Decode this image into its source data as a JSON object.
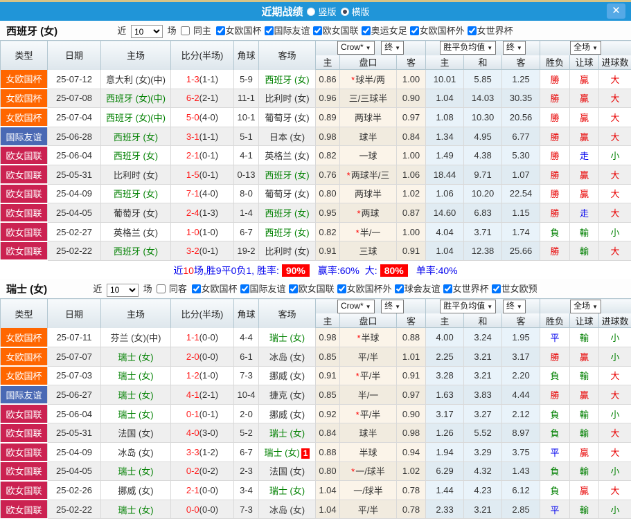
{
  "titlebar": {
    "title": "近期战绩",
    "radio_vertical": "竖版",
    "radio_horizontal": "横版",
    "close": "✕"
  },
  "accent_colors": {
    "bar_blue": "#2095d8",
    "cup_orange": "#ff6600",
    "friendly_blue": "#4a69b4",
    "league_pink": "#cb2251",
    "win_red": "#ff0000",
    "lose_green": "#008000",
    "draw_blue": "#0000ee"
  },
  "table": {
    "main_cols": [
      "类型",
      "日期",
      "主场",
      "比分(半场)",
      "角球",
      "客场"
    ],
    "sub_cols": [
      "主",
      "盘口",
      "客",
      "主",
      "和",
      "客",
      "胜负",
      "让球",
      "进球数"
    ],
    "controls": {
      "odds_source": "Crow*",
      "final_a": "终",
      "avg": "胜平负均值",
      "final_b": "终",
      "scope": "全场"
    }
  },
  "filters_common": {
    "near": "近",
    "count": "10",
    "matches": "场"
  },
  "sections": [
    {
      "team": "西班牙 (女)",
      "same": "同主",
      "comps": [
        "女欧国杯",
        "国际友谊",
        "欧女国联",
        "奥运女足",
        "女欧国杯外",
        "女世界杯"
      ],
      "rows": [
        {
          "type": "女欧国杯",
          "tc": "o",
          "date": "25-07-12",
          "home": "意大利 (女)(中)",
          "hg": 0,
          "score": "1-3",
          "half": "(1-1)",
          "corner": "5-9",
          "away": "西班牙 (女)",
          "ag": 1,
          "badge": "",
          "o1": "0.86",
          "star": 1,
          "hcap": "球半/两",
          "o2": "1.00",
          "m1": "10.01",
          "m2": "5.85",
          "m3": "1.25",
          "r": "勝",
          "rc": "r",
          "lb": "贏",
          "lbc": "r",
          "gl": "大",
          "glc": "r"
        },
        {
          "type": "女欧国杯",
          "tc": "o",
          "date": "25-07-08",
          "home": "西班牙 (女)(中)",
          "hg": 1,
          "score": "6-2",
          "half": "(2-1)",
          "corner": "11-1",
          "away": "比利时 (女)",
          "ag": 0,
          "badge": "",
          "o1": "0.96",
          "star": 0,
          "hcap": "三/三球半",
          "o2": "0.90",
          "m1": "1.04",
          "m2": "14.03",
          "m3": "30.35",
          "r": "勝",
          "rc": "r",
          "lb": "贏",
          "lbc": "r",
          "gl": "大",
          "glc": "r"
        },
        {
          "type": "女欧国杯",
          "tc": "o",
          "date": "25-07-04",
          "home": "西班牙 (女)(中)",
          "hg": 1,
          "score": "5-0",
          "half": "(4-0)",
          "corner": "10-1",
          "away": "葡萄牙 (女)",
          "ag": 0,
          "badge": "",
          "o1": "0.89",
          "star": 0,
          "hcap": "两球半",
          "o2": "0.97",
          "m1": "1.08",
          "m2": "10.30",
          "m3": "20.56",
          "r": "勝",
          "rc": "r",
          "lb": "贏",
          "lbc": "r",
          "gl": "大",
          "glc": "r"
        },
        {
          "type": "国际友谊",
          "tc": "b",
          "date": "25-06-28",
          "home": "西班牙 (女)",
          "hg": 1,
          "score": "3-1",
          "half": "(1-1)",
          "corner": "5-1",
          "away": "日本 (女)",
          "ag": 0,
          "badge": "",
          "o1": "0.98",
          "star": 0,
          "hcap": "球半",
          "o2": "0.84",
          "m1": "1.34",
          "m2": "4.95",
          "m3": "6.77",
          "r": "勝",
          "rc": "r",
          "lb": "贏",
          "lbc": "r",
          "gl": "大",
          "glc": "r"
        },
        {
          "type": "欧女国联",
          "tc": "p",
          "date": "25-06-04",
          "home": "西班牙 (女)",
          "hg": 1,
          "score": "2-1",
          "half": "(0-1)",
          "corner": "4-1",
          "away": "英格兰 (女)",
          "ag": 0,
          "badge": "",
          "o1": "0.82",
          "star": 0,
          "hcap": "一球",
          "o2": "1.00",
          "m1": "1.49",
          "m2": "4.38",
          "m3": "5.30",
          "r": "勝",
          "rc": "r",
          "lb": "走",
          "lbc": "b",
          "gl": "小",
          "glc": "g"
        },
        {
          "type": "欧女国联",
          "tc": "p",
          "date": "25-05-31",
          "home": "比利时 (女)",
          "hg": 0,
          "score": "1-5",
          "half": "(0-1)",
          "corner": "0-13",
          "away": "西班牙 (女)",
          "ag": 1,
          "badge": "",
          "o1": "0.76",
          "star": 1,
          "hcap": "两球半/三",
          "o2": "1.06",
          "m1": "18.44",
          "m2": "9.71",
          "m3": "1.07",
          "r": "勝",
          "rc": "r",
          "lb": "贏",
          "lbc": "r",
          "gl": "大",
          "glc": "r"
        },
        {
          "type": "欧女国联",
          "tc": "p",
          "date": "25-04-09",
          "home": "西班牙 (女)",
          "hg": 1,
          "score": "7-1",
          "half": "(4-0)",
          "corner": "8-0",
          "away": "葡萄牙 (女)",
          "ag": 0,
          "badge": "",
          "o1": "0.80",
          "star": 0,
          "hcap": "两球半",
          "o2": "1.02",
          "m1": "1.06",
          "m2": "10.20",
          "m3": "22.54",
          "r": "勝",
          "rc": "r",
          "lb": "贏",
          "lbc": "r",
          "gl": "大",
          "glc": "r"
        },
        {
          "type": "欧女国联",
          "tc": "p",
          "date": "25-04-05",
          "home": "葡萄牙 (女)",
          "hg": 0,
          "score": "2-4",
          "half": "(1-3)",
          "corner": "1-4",
          "away": "西班牙 (女)",
          "ag": 1,
          "badge": "",
          "o1": "0.95",
          "star": 1,
          "hcap": "两球",
          "o2": "0.87",
          "m1": "14.60",
          "m2": "6.83",
          "m3": "1.15",
          "r": "勝",
          "rc": "r",
          "lb": "走",
          "lbc": "b",
          "gl": "大",
          "glc": "r"
        },
        {
          "type": "欧女国联",
          "tc": "p",
          "date": "25-02-27",
          "home": "英格兰 (女)",
          "hg": 0,
          "score": "1-0",
          "half": "(1-0)",
          "corner": "6-7",
          "away": "西班牙 (女)",
          "ag": 1,
          "badge": "",
          "o1": "0.82",
          "star": 1,
          "hcap": "半/一",
          "o2": "1.00",
          "m1": "4.04",
          "m2": "3.71",
          "m3": "1.74",
          "r": "負",
          "rc": "g",
          "lb": "輸",
          "lbc": "g",
          "gl": "小",
          "glc": "g"
        },
        {
          "type": "欧女国联",
          "tc": "p",
          "date": "25-02-22",
          "home": "西班牙 (女)",
          "hg": 1,
          "score": "3-2",
          "half": "(0-1)",
          "corner": "19-2",
          "away": "比利时 (女)",
          "ag": 0,
          "badge": "",
          "o1": "0.91",
          "star": 0,
          "hcap": "三球",
          "o2": "0.91",
          "m1": "1.04",
          "m2": "12.38",
          "m3": "25.66",
          "r": "勝",
          "rc": "r",
          "lb": "輸",
          "lbc": "g",
          "gl": "大",
          "glc": "r"
        }
      ],
      "summary": {
        "t1": "近",
        "t2": "10",
        "t3": "场,胜9平0负1, 胜率:",
        "b1": "90%",
        "t4": "赢率:",
        "t5": "60%",
        "t6": "大:",
        "b2": "80%",
        "t7": "单率:",
        "t8": "40%"
      }
    },
    {
      "team": "瑞士 (女)",
      "same": "同客",
      "comps": [
        "女欧国杯",
        "国际友谊",
        "欧女国联",
        "女欧国杯外",
        "球会友谊",
        "女世界杯",
        "世女欧预"
      ],
      "rows": [
        {
          "type": "女欧国杯",
          "tc": "o",
          "date": "25-07-11",
          "home": "芬兰 (女)(中)",
          "hg": 0,
          "score": "1-1",
          "half": "(0-0)",
          "corner": "4-4",
          "away": "瑞士 (女)",
          "ag": 1,
          "badge": "",
          "o1": "0.98",
          "star": 1,
          "hcap": "半球",
          "o2": "0.88",
          "m1": "4.00",
          "m2": "3.24",
          "m3": "1.95",
          "r": "平",
          "rc": "b",
          "lb": "輸",
          "lbc": "g",
          "gl": "小",
          "glc": "g"
        },
        {
          "type": "女欧国杯",
          "tc": "o",
          "date": "25-07-07",
          "home": "瑞士 (女)",
          "hg": 1,
          "score": "2-0",
          "half": "(0-0)",
          "corner": "6-1",
          "away": "冰岛 (女)",
          "ag": 0,
          "badge": "",
          "o1": "0.85",
          "star": 0,
          "hcap": "平/半",
          "o2": "1.01",
          "m1": "2.25",
          "m2": "3.21",
          "m3": "3.17",
          "r": "勝",
          "rc": "r",
          "lb": "贏",
          "lbc": "r",
          "gl": "小",
          "glc": "g"
        },
        {
          "type": "女欧国杯",
          "tc": "o",
          "date": "25-07-03",
          "home": "瑞士 (女)",
          "hg": 1,
          "score": "1-2",
          "half": "(1-0)",
          "corner": "7-3",
          "away": "挪威 (女)",
          "ag": 0,
          "badge": "",
          "o1": "0.91",
          "star": 1,
          "hcap": "平/半",
          "o2": "0.91",
          "m1": "3.28",
          "m2": "3.21",
          "m3": "2.20",
          "r": "負",
          "rc": "g",
          "lb": "輸",
          "lbc": "g",
          "gl": "大",
          "glc": "r"
        },
        {
          "type": "国际友谊",
          "tc": "b",
          "date": "25-06-27",
          "home": "瑞士 (女)",
          "hg": 1,
          "score": "4-1",
          "half": "(2-1)",
          "corner": "10-4",
          "away": "捷克 (女)",
          "ag": 0,
          "badge": "",
          "o1": "0.85",
          "star": 0,
          "hcap": "半/一",
          "o2": "0.97",
          "m1": "1.63",
          "m2": "3.83",
          "m3": "4.44",
          "r": "勝",
          "rc": "r",
          "lb": "贏",
          "lbc": "r",
          "gl": "大",
          "glc": "r"
        },
        {
          "type": "欧女国联",
          "tc": "p",
          "date": "25-06-04",
          "home": "瑞士 (女)",
          "hg": 1,
          "score": "0-1",
          "half": "(0-1)",
          "corner": "2-0",
          "away": "挪威 (女)",
          "ag": 0,
          "badge": "",
          "o1": "0.92",
          "star": 1,
          "hcap": "平/半",
          "o2": "0.90",
          "m1": "3.17",
          "m2": "3.27",
          "m3": "2.12",
          "r": "負",
          "rc": "g",
          "lb": "輸",
          "lbc": "g",
          "gl": "小",
          "glc": "g"
        },
        {
          "type": "欧女国联",
          "tc": "p",
          "date": "25-05-31",
          "home": "法国 (女)",
          "hg": 0,
          "score": "4-0",
          "half": "(3-0)",
          "corner": "5-2",
          "away": "瑞士 (女)",
          "ag": 1,
          "badge": "",
          "o1": "0.84",
          "star": 0,
          "hcap": "球半",
          "o2": "0.98",
          "m1": "1.26",
          "m2": "5.52",
          "m3": "8.97",
          "r": "負",
          "rc": "g",
          "lb": "輸",
          "lbc": "g",
          "gl": "大",
          "glc": "r"
        },
        {
          "type": "欧女国联",
          "tc": "p",
          "date": "25-04-09",
          "home": "冰岛 (女)",
          "hg": 0,
          "score": "3-3",
          "half": "(1-2)",
          "corner": "6-7",
          "away": "瑞士 (女)",
          "ag": 1,
          "badge": "1",
          "o1": "0.88",
          "star": 0,
          "hcap": "半球",
          "o2": "0.94",
          "m1": "1.94",
          "m2": "3.29",
          "m3": "3.75",
          "r": "平",
          "rc": "b",
          "lb": "贏",
          "lbc": "r",
          "gl": "大",
          "glc": "r"
        },
        {
          "type": "欧女国联",
          "tc": "p",
          "date": "25-04-05",
          "home": "瑞士 (女)",
          "hg": 1,
          "score": "0-2",
          "half": "(0-2)",
          "corner": "2-3",
          "away": "法国 (女)",
          "ag": 0,
          "badge": "",
          "o1": "0.80",
          "star": 1,
          "hcap": "一/球半",
          "o2": "1.02",
          "m1": "6.29",
          "m2": "4.32",
          "m3": "1.43",
          "r": "負",
          "rc": "g",
          "lb": "輸",
          "lbc": "g",
          "gl": "小",
          "glc": "g"
        },
        {
          "type": "欧女国联",
          "tc": "p",
          "date": "25-02-26",
          "home": "挪威 (女)",
          "hg": 0,
          "score": "2-1",
          "half": "(0-0)",
          "corner": "3-4",
          "away": "瑞士 (女)",
          "ag": 1,
          "badge": "",
          "o1": "1.04",
          "star": 0,
          "hcap": "一/球半",
          "o2": "0.78",
          "m1": "1.44",
          "m2": "4.23",
          "m3": "6.12",
          "r": "負",
          "rc": "g",
          "lb": "贏",
          "lbc": "r",
          "gl": "大",
          "glc": "r"
        },
        {
          "type": "欧女国联",
          "tc": "p",
          "date": "25-02-22",
          "home": "瑞士 (女)",
          "hg": 1,
          "score": "0-0",
          "half": "(0-0)",
          "corner": "7-3",
          "away": "冰岛 (女)",
          "ag": 0,
          "badge": "",
          "o1": "1.04",
          "star": 0,
          "hcap": "平/半",
          "o2": "0.78",
          "m1": "2.33",
          "m2": "3.21",
          "m3": "2.85",
          "r": "平",
          "rc": "b",
          "lb": "輸",
          "lbc": "g",
          "gl": "小",
          "glc": "g"
        }
      ]
    }
  ]
}
